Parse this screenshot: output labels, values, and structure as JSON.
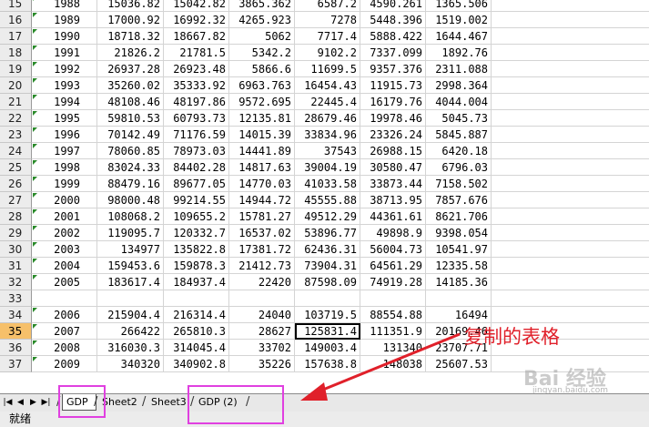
{
  "rows": [
    {
      "num": "15",
      "cells": [
        "1988",
        "15036.82",
        "15042.82",
        "3865.362",
        "6587.2",
        "4590.261",
        "1365.506"
      ]
    },
    {
      "num": "16",
      "cells": [
        "1989",
        "17000.92",
        "16992.32",
        "4265.923",
        "7278",
        "5448.396",
        "1519.002"
      ]
    },
    {
      "num": "17",
      "cells": [
        "1990",
        "18718.32",
        "18667.82",
        "5062",
        "7717.4",
        "5888.422",
        "1644.467"
      ]
    },
    {
      "num": "18",
      "cells": [
        "1991",
        "21826.2",
        "21781.5",
        "5342.2",
        "9102.2",
        "7337.099",
        "1892.76"
      ]
    },
    {
      "num": "19",
      "cells": [
        "1992",
        "26937.28",
        "26923.48",
        "5866.6",
        "11699.5",
        "9357.376",
        "2311.088"
      ]
    },
    {
      "num": "20",
      "cells": [
        "1993",
        "35260.02",
        "35333.92",
        "6963.763",
        "16454.43",
        "11915.73",
        "2998.364"
      ]
    },
    {
      "num": "21",
      "cells": [
        "1994",
        "48108.46",
        "48197.86",
        "9572.695",
        "22445.4",
        "16179.76",
        "4044.004"
      ]
    },
    {
      "num": "22",
      "cells": [
        "1995",
        "59810.53",
        "60793.73",
        "12135.81",
        "28679.46",
        "19978.46",
        "5045.73"
      ]
    },
    {
      "num": "23",
      "cells": [
        "1996",
        "70142.49",
        "71176.59",
        "14015.39",
        "33834.96",
        "23326.24",
        "5845.887"
      ]
    },
    {
      "num": "24",
      "cells": [
        "1997",
        "78060.85",
        "78973.03",
        "14441.89",
        "37543",
        "26988.15",
        "6420.18"
      ]
    },
    {
      "num": "25",
      "cells": [
        "1998",
        "83024.33",
        "84402.28",
        "14817.63",
        "39004.19",
        "30580.47",
        "6796.03"
      ]
    },
    {
      "num": "26",
      "cells": [
        "1999",
        "88479.16",
        "89677.05",
        "14770.03",
        "41033.58",
        "33873.44",
        "7158.502"
      ]
    },
    {
      "num": "27",
      "cells": [
        "2000",
        "98000.48",
        "99214.55",
        "14944.72",
        "45555.88",
        "38713.95",
        "7857.676"
      ]
    },
    {
      "num": "28",
      "cells": [
        "2001",
        "108068.2",
        "109655.2",
        "15781.27",
        "49512.29",
        "44361.61",
        "8621.706"
      ]
    },
    {
      "num": "29",
      "cells": [
        "2002",
        "119095.7",
        "120332.7",
        "16537.02",
        "53896.77",
        "49898.9",
        "9398.054"
      ]
    },
    {
      "num": "30",
      "cells": [
        "2003",
        "134977",
        "135822.8",
        "17381.72",
        "62436.31",
        "56004.73",
        "10541.97"
      ]
    },
    {
      "num": "31",
      "cells": [
        "2004",
        "159453.6",
        "159878.3",
        "21412.73",
        "73904.31",
        "64561.29",
        "12335.58"
      ]
    },
    {
      "num": "32",
      "cells": [
        "2005",
        "183617.4",
        "184937.4",
        "22420",
        "87598.09",
        "74919.28",
        "14185.36"
      ]
    },
    {
      "num": "33",
      "cells": [
        "",
        "",
        "",
        "",
        "",
        "",
        ""
      ]
    },
    {
      "num": "34",
      "cells": [
        "2006",
        "215904.4",
        "216314.4",
        "24040",
        "103719.5",
        "88554.88",
        "16494"
      ]
    },
    {
      "num": "35",
      "cells": [
        "2007",
        "266422",
        "265810.3",
        "28627",
        "125831.4",
        "111351.9",
        "20169.46"
      ]
    },
    {
      "num": "36",
      "cells": [
        "2008",
        "316030.3",
        "314045.4",
        "33702",
        "149003.4",
        "131340",
        "23707.71"
      ]
    },
    {
      "num": "37",
      "cells": [
        "2009",
        "340320",
        "340902.8",
        "35226",
        "157638.8",
        "148038",
        "25607.53"
      ]
    }
  ],
  "tabs": [
    "GDP",
    "Sheet2",
    "Sheet3",
    "GDP (2)"
  ],
  "status": "就绪",
  "annotation": "复制的表格",
  "watermark": "Bai 经验",
  "watermark_sub": "jingyan.baidu.com",
  "colors": {
    "highlight": "#e040e0",
    "arrow": "#e0202a",
    "active_row": "#f6c06a"
  }
}
